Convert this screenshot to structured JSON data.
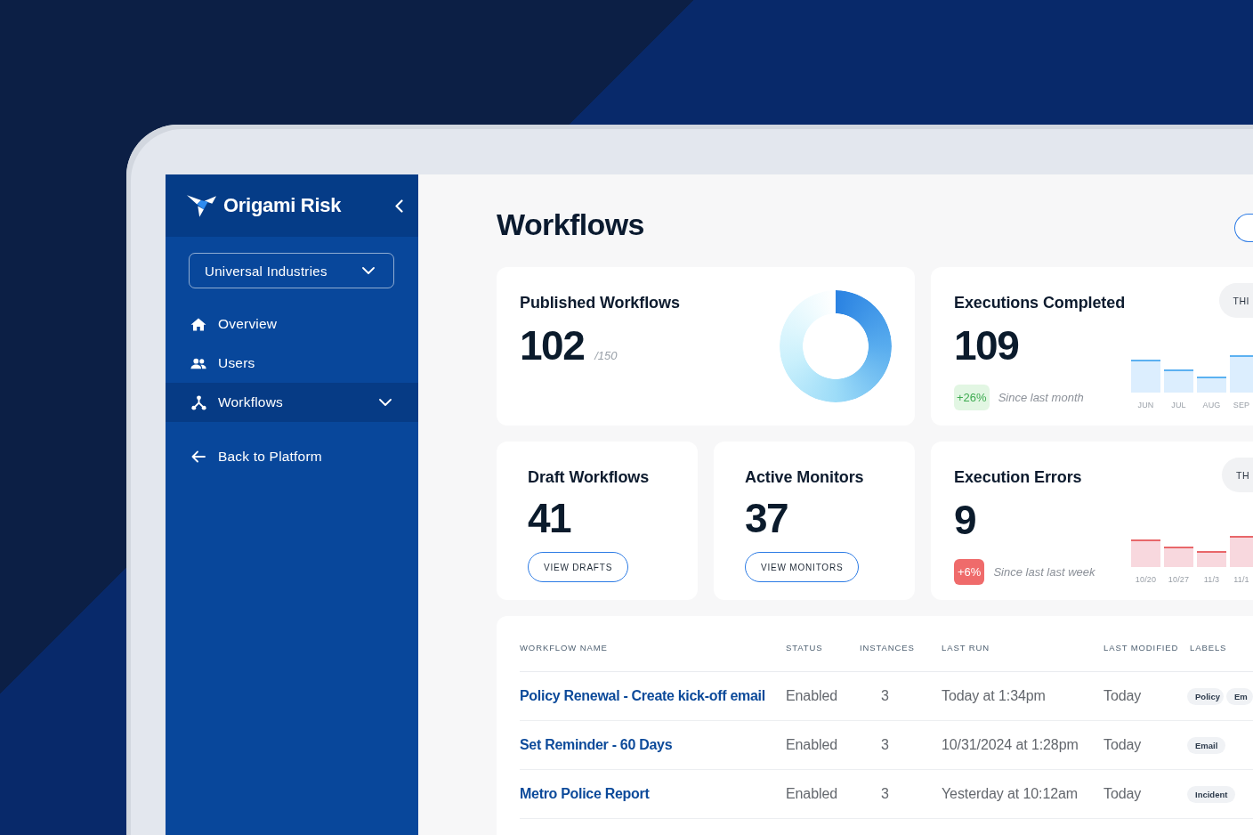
{
  "sidebar": {
    "logo": "Origami Risk",
    "account": "Universal Industries",
    "nav": [
      {
        "label": "Overview",
        "selected": false,
        "expandable": false
      },
      {
        "label": "Users",
        "selected": false,
        "expandable": false
      },
      {
        "label": "Workflows",
        "selected": true,
        "expandable": true
      }
    ],
    "back_link": "Back to Platform"
  },
  "page": {
    "title": "Workflows"
  },
  "stat_rows": [
    {
      "cards": [
        {
          "kind": "donut",
          "title": "Published Workflows",
          "value": "102",
          "total": "/150"
        },
        {
          "kind": "trend",
          "title": "Executions Completed",
          "value": "109",
          "period": "THI",
          "change": "+26%",
          "change_note": "Since last month",
          "chart_labels": [
            "JUN",
            "JUL",
            "AUG",
            "SEP"
          ]
        }
      ]
    },
    {
      "cards": [
        {
          "kind": "action",
          "title": "Draft Workflows",
          "value": "41",
          "button": "VIEW DRAFTS"
        },
        {
          "kind": "action",
          "title": "Active Monitors",
          "value": "37",
          "button": "VIEW MONITORS"
        },
        {
          "kind": "alert",
          "title": "Execution Errors",
          "value": "9",
          "period": "TH",
          "change": "+6%",
          "change_note": "Since last last week",
          "chart_labels": [
            "10/20",
            "10/27",
            "11/3",
            "11/1"
          ]
        }
      ]
    }
  ],
  "table": {
    "columns": [
      "WORKFLOW NAME",
      "STATUS",
      "INSTANCES",
      "LAST RUN",
      "LAST MODIFIED",
      "LABELS"
    ],
    "rows": [
      {
        "name": "Policy Renewal - Create kick-off email",
        "status": "Enabled",
        "instances": "3",
        "last_run": "Today at 1:34pm",
        "last_modified": "Today",
        "labels": [
          "Policy",
          "Em"
        ]
      },
      {
        "name": "Set Reminder - 60 Days",
        "status": "Enabled",
        "instances": "3",
        "last_run": "10/31/2024 at 1:28pm",
        "last_modified": "Today",
        "labels": [
          "Email"
        ]
      },
      {
        "name": "Metro Police Report",
        "status": "Enabled",
        "instances": "3",
        "last_run": "Yesterday at 10:12am",
        "last_modified": "Today",
        "labels": [
          "Incident"
        ]
      }
    ]
  }
}
